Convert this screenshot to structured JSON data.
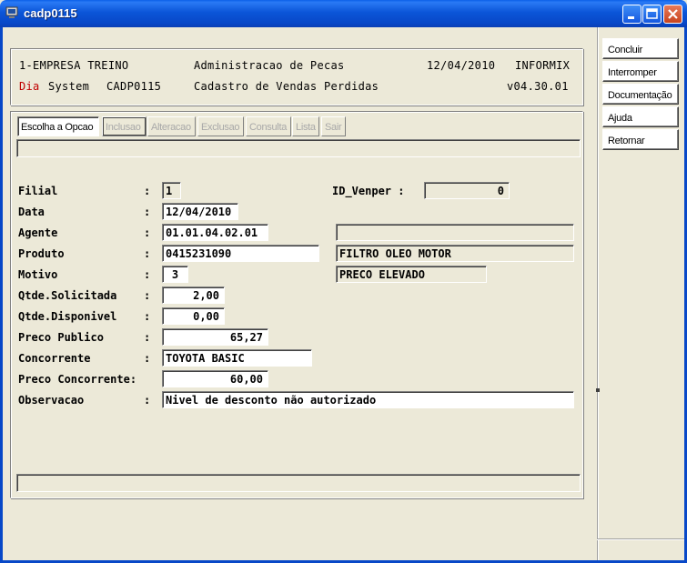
{
  "window": {
    "title": "cadp0115"
  },
  "header": {
    "company": "1-EMPRESA TREINO",
    "module": "Administracao de Pecas",
    "date": "12/04/2010",
    "db": "INFORMIX",
    "day": "Dia",
    "system": "System",
    "program": "CADP0115",
    "screen": "Cadastro de Vendas Perdidas",
    "version": "v04.30.01"
  },
  "tabs": [
    "Escolha a Opcao",
    "Inclusao",
    "Alteracao",
    "Exclusao",
    "Consulta",
    "Lista",
    "Sair"
  ],
  "sidebar": [
    "Concluir",
    "Interromper",
    "Documentação",
    "Ajuda",
    "Retornar"
  ],
  "form": {
    "colon": ":",
    "filial": {
      "label": "Filial",
      "value": "1"
    },
    "id_venper": {
      "label": "ID_Venper :",
      "value": "0"
    },
    "data": {
      "label": "Data",
      "value": "12/04/2010"
    },
    "agente": {
      "label": "Agente",
      "value": "01.01.04.02.01",
      "desc": ""
    },
    "produto": {
      "label": "Produto",
      "value": "0415231090",
      "desc": "FILTRO OLEO MOTOR"
    },
    "motivo": {
      "label": "Motivo",
      "value": "3",
      "desc": "PRECO ELEVADO"
    },
    "qtde_solicitada": {
      "label": "Qtde.Solicitada",
      "value": "2,00"
    },
    "qtde_disponivel": {
      "label": "Qtde.Disponivel",
      "value": "0,00"
    },
    "preco_publico": {
      "label": "Preco Publico",
      "value": "65,27"
    },
    "concorrente": {
      "label": "Concorrente",
      "value": "TOYOTA BASIC"
    },
    "preco_concorrente": {
      "label": "Preco Concorrente:",
      "value": "60,00"
    },
    "observacao": {
      "label": "Observacao",
      "value": "Nivel de desconto não autorizado"
    }
  },
  "status": {
    "message": "",
    "bottom": ""
  }
}
